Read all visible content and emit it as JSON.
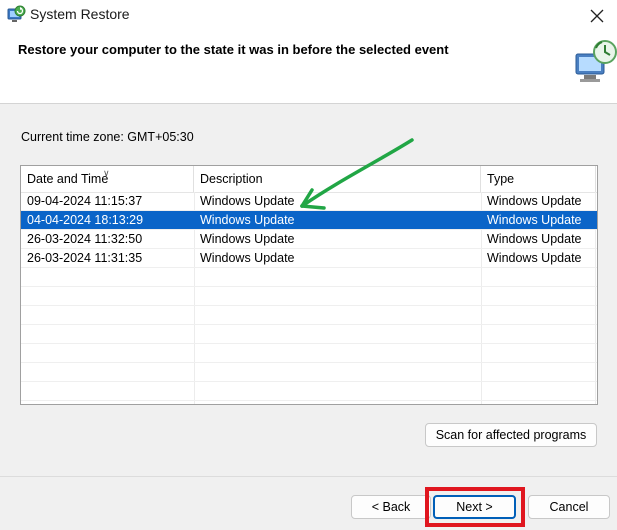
{
  "window": {
    "title": "System Restore",
    "icons": {
      "app": "system-restore-icon",
      "close": "close-icon",
      "header": "computer-restore-icon"
    }
  },
  "header": {
    "text": "Restore your computer to the state it was in before the selected event"
  },
  "timezone": "Current time zone: GMT+05:30",
  "table": {
    "columns": [
      "Date and Time",
      "Description",
      "Type"
    ],
    "rows": [
      {
        "date": "09-04-2024 11:15:37",
        "description": "Windows Update",
        "type": "Windows Update",
        "selected": false
      },
      {
        "date": "04-04-2024 18:13:29",
        "description": "Windows Update",
        "type": "Windows Update",
        "selected": true
      },
      {
        "date": "26-03-2024 11:32:50",
        "description": "Windows Update",
        "type": "Windows Update",
        "selected": false
      },
      {
        "date": "26-03-2024 11:31:35",
        "description": "Windows Update",
        "type": "Windows Update",
        "selected": false
      }
    ]
  },
  "buttons": {
    "scan": "Scan for affected programs",
    "back": "< Back",
    "next": "Next >",
    "cancel": "Cancel"
  },
  "annotations": {
    "arrow_color": "#21a645",
    "highlight_color": "#e0161f"
  },
  "colors": {
    "selection": "#0a64c8",
    "primary_border": "#005fb8"
  }
}
